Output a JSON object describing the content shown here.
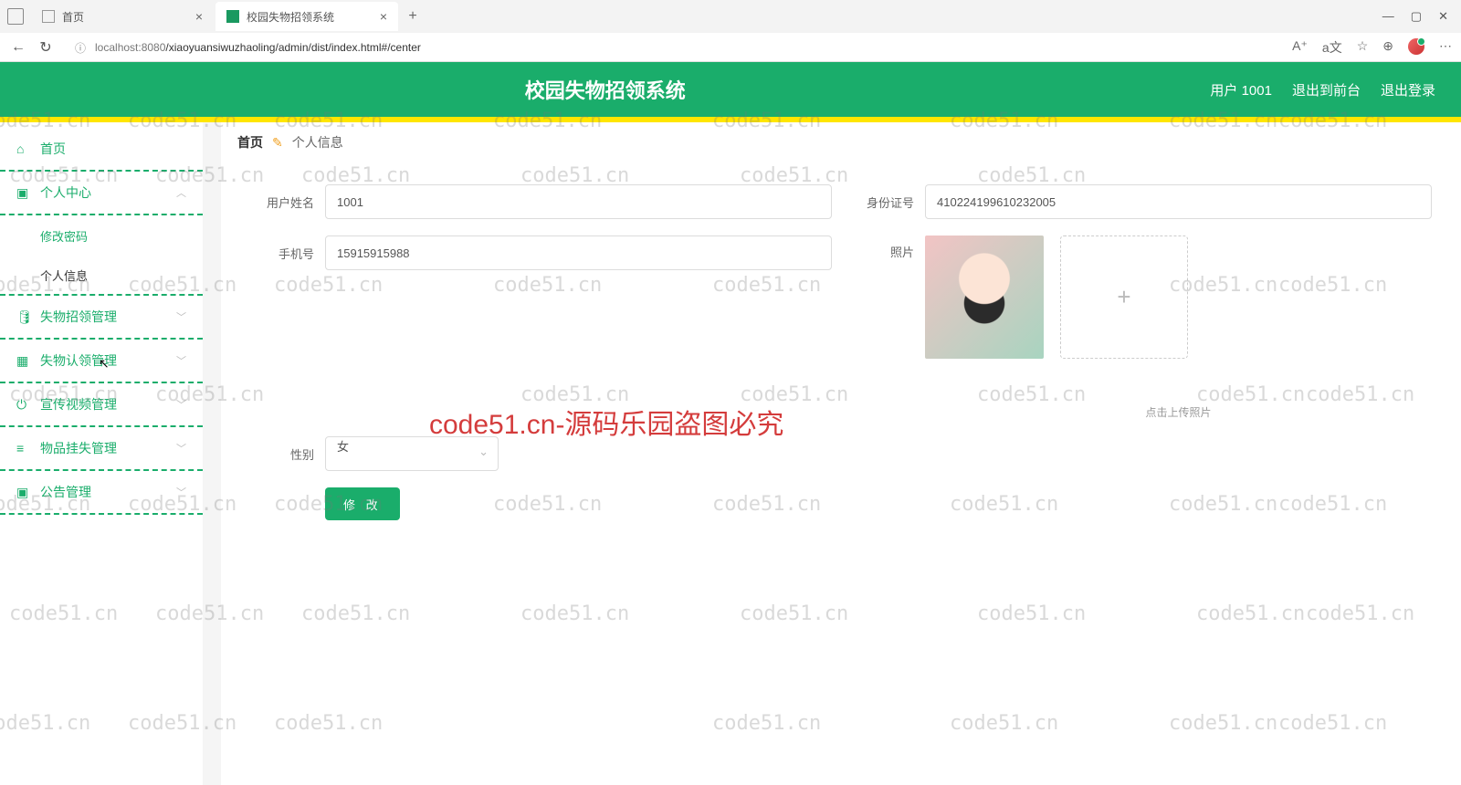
{
  "browser": {
    "tabs": [
      {
        "title": "首页"
      },
      {
        "title": "校园失物招领系统"
      }
    ],
    "url_host": "localhost:8080",
    "url_path": "/xiaoyuansiwuzhaoling/admin/dist/index.html#/center",
    "win_min": "—",
    "win_max": "▢",
    "win_close": "✕"
  },
  "header": {
    "title": "校园失物招领系统",
    "user": "用户 1001",
    "exit_front": "退出到前台",
    "logout": "退出登录"
  },
  "sidebar": {
    "items": [
      {
        "label": "首页",
        "icon": "⌂"
      },
      {
        "label": "个人中心",
        "icon": "👤",
        "open": true,
        "children": [
          {
            "label": "修改密码"
          },
          {
            "label": "个人信息",
            "current": true
          }
        ]
      },
      {
        "label": "失物招领管理",
        "icon": "❐"
      },
      {
        "label": "失物认领管理",
        "icon": "▦"
      },
      {
        "label": "宣传视频管理",
        "icon": "⏻"
      },
      {
        "label": "物品挂失管理",
        "icon": "≡"
      },
      {
        "label": "公告管理",
        "icon": "👤"
      }
    ]
  },
  "breadcrumb": {
    "home": "首页",
    "sep": "✎",
    "current": "个人信息"
  },
  "form": {
    "username_label": "用户姓名",
    "username_value": "1001",
    "idcard_label": "身份证号",
    "idcard_value": "410224199610232005",
    "phone_label": "手机号",
    "phone_value": "15915915988",
    "photo_label": "照片",
    "photo_hint": "点击上传照片",
    "gender_label": "性别",
    "gender_value": "女",
    "submit": "修 改"
  },
  "watermark": {
    "text": "code51.cn",
    "banner": "code51.cn-源码乐园盗图必究"
  }
}
